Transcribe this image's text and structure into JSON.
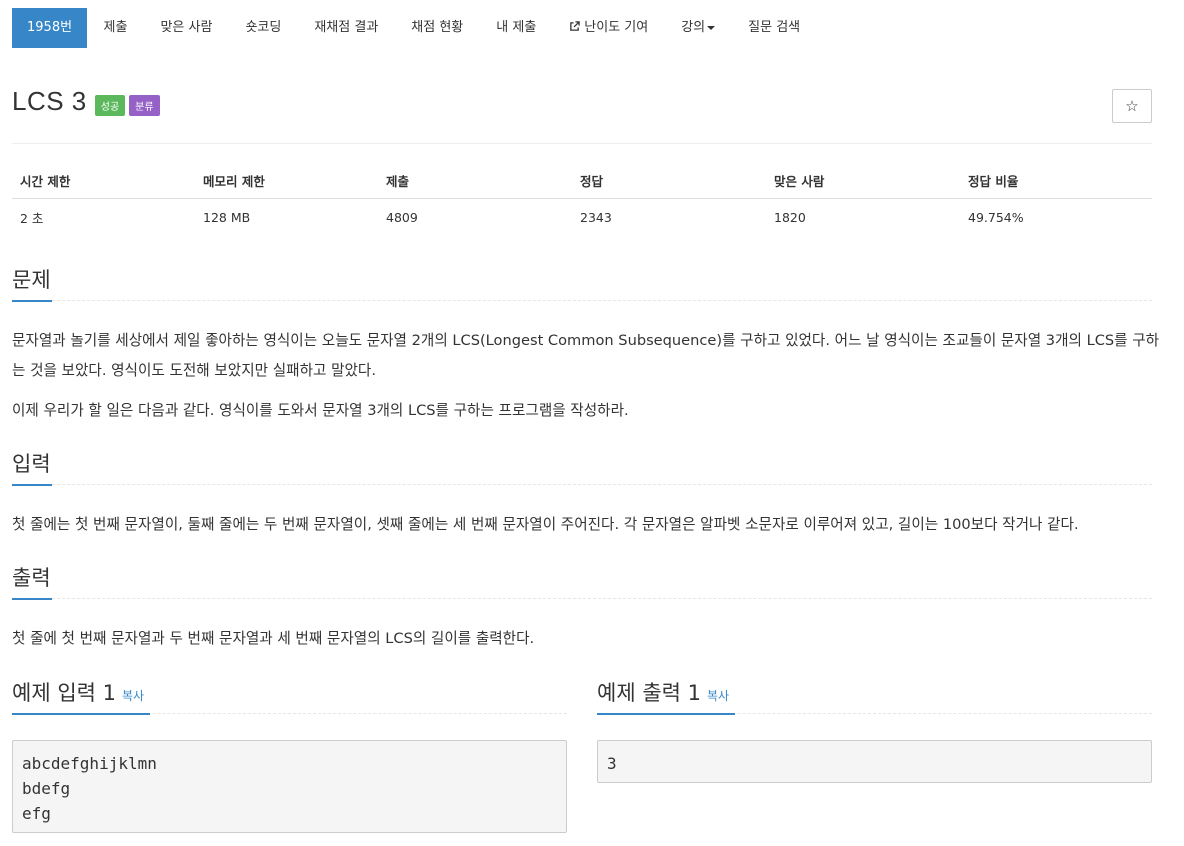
{
  "nav": {
    "items": [
      {
        "label": "1958번"
      },
      {
        "label": "제출"
      },
      {
        "label": "맞은 사람"
      },
      {
        "label": "숏코딩"
      },
      {
        "label": "재채점 결과"
      },
      {
        "label": "채점 현황"
      },
      {
        "label": "내 제출"
      },
      {
        "label": "난이도 기여"
      },
      {
        "label": "강의"
      },
      {
        "label": "질문 검색"
      }
    ]
  },
  "problem": {
    "title": "LCS 3",
    "badge_success": "성공",
    "badge_category": "분류",
    "star_label": "☆"
  },
  "info": {
    "headers": [
      "시간 제한",
      "메모리 제한",
      "제출",
      "정답",
      "맞은 사람",
      "정답 비율"
    ],
    "values": [
      "2 초",
      "128 MB",
      "4809",
      "2343",
      "1820",
      "49.754%"
    ]
  },
  "sections": {
    "problem_heading": "문제",
    "problem_p1": "문자열과 놀기를 세상에서 제일 좋아하는 영식이는 오늘도 문자열 2개의 LCS(Longest Common Subsequence)를 구하고 있었다. 어느 날 영식이는 조교들이 문자열 3개의 LCS를 구하는 것을 보았다. 영식이도 도전해 보았지만 실패하고 말았다.",
    "problem_p2": "이제 우리가 할 일은 다음과 같다. 영식이를 도와서 문자열 3개의 LCS를 구하는 프로그램을 작성하라.",
    "input_heading": "입력",
    "input_text": "첫 줄에는 첫 번째 문자열이, 둘째 줄에는 두 번째 문자열이, 셋째 줄에는 세 번째 문자열이 주어진다. 각 문자열은 알파벳 소문자로 이루어져 있고, 길이는 100보다 작거나 같다.",
    "output_heading": "출력",
    "output_text": "첫 줄에 첫 번째 문자열과 두 번째 문자열과 세 번째 문자열의 LCS의 길이를 출력한다."
  },
  "samples": {
    "input_heading": "예제 입력 1",
    "output_heading": "예제 출력 1",
    "copy_label": "복사",
    "input_text": "abcdefghijklmn\nbdefg\nefg",
    "output_text": "3"
  }
}
